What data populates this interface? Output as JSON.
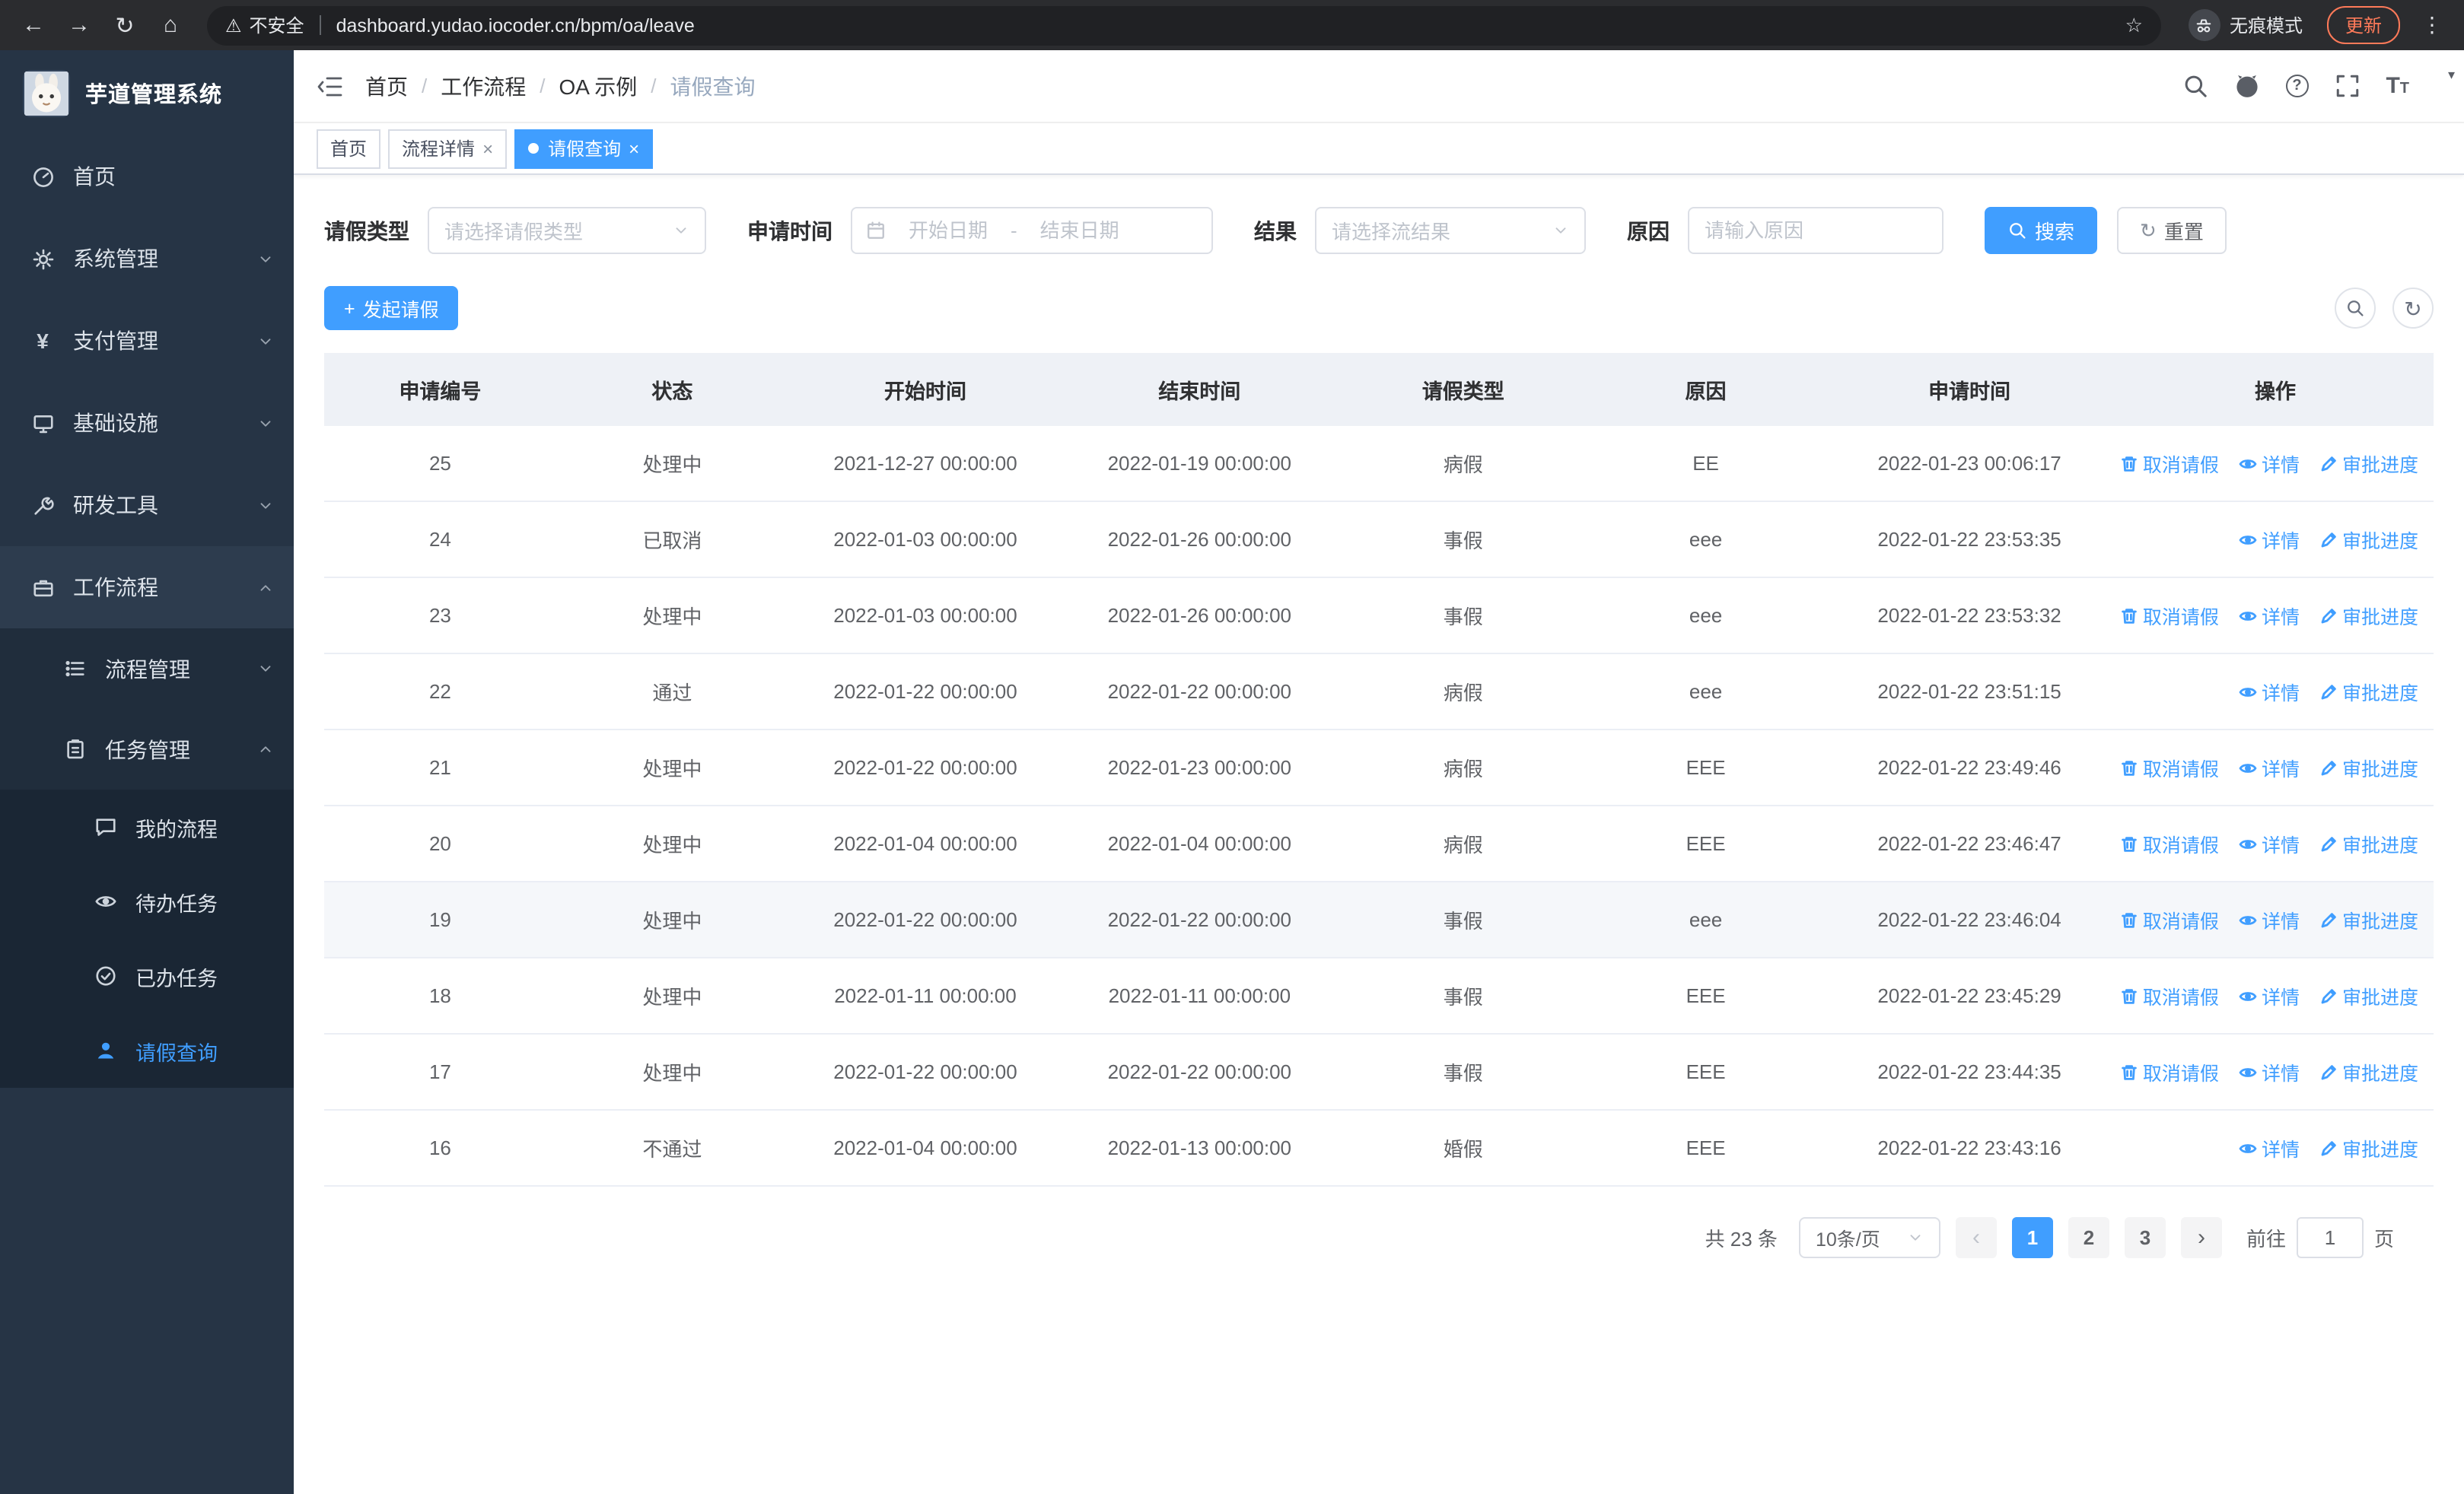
{
  "colors": {
    "accent": "#409eff",
    "sidebar_bg": "#263445",
    "update_pill": "#ff7a59",
    "table_header_bg": "#eef1f6"
  },
  "icons": {
    "close": "×",
    "caret_down": "▾"
  },
  "browser": {
    "back_icon": "←",
    "forward_icon": "→",
    "reload_icon": "↻",
    "home_icon": "⌂",
    "warning_icon": "⚠",
    "security_label": "不安全",
    "url": "dashboard.yudao.iocoder.cn/bpm/oa/leave",
    "star_icon": "☆",
    "incognito_label": "无痕模式",
    "update_label": "更新",
    "menu_dots_icon": "⋮"
  },
  "sidebar": {
    "logo_title": "芋道管理系统",
    "menu": [
      {
        "label": "首页"
      },
      {
        "label": "系统管理"
      },
      {
        "label": "支付管理"
      },
      {
        "label": "基础设施"
      },
      {
        "label": "研发工具"
      },
      {
        "label": "工作流程"
      },
      {
        "label": "流程管理"
      },
      {
        "label": "任务管理"
      },
      {
        "label": "我的流程"
      },
      {
        "label": "待办任务"
      },
      {
        "label": "已办任务"
      },
      {
        "label": "请假查询"
      }
    ]
  },
  "breadcrumb": {
    "items": [
      "首页",
      "工作流程",
      "OA 示例",
      "请假查询"
    ],
    "separator": "/"
  },
  "tabs": [
    {
      "label": "首页"
    },
    {
      "label": "流程详情"
    },
    {
      "label": "请假查询"
    }
  ],
  "filters": {
    "leave_type_label": "请假类型",
    "leave_type_placeholder": "请选择请假类型",
    "apply_time_label": "申请时间",
    "start_placeholder": "开始日期",
    "range_separator": "-",
    "end_placeholder": "结束日期",
    "result_label": "结果",
    "result_placeholder": "请选择流结果",
    "reason_label": "原因",
    "reason_placeholder": "请输入原因",
    "search_label": "搜索",
    "reset_label": "重置"
  },
  "toolbar": {
    "plus_icon": "+",
    "create_label": "发起请假"
  },
  "table": {
    "headers": [
      "申请编号",
      "状态",
      "开始时间",
      "结束时间",
      "请假类型",
      "原因",
      "申请时间",
      "操作"
    ],
    "action_labels": {
      "cancel": "取消请假",
      "detail": "详情",
      "progress": "审批进度"
    },
    "rows": [
      {
        "id": "25",
        "status": "处理中",
        "start": "2021-12-27 00:00:00",
        "end": "2022-01-19 00:00:00",
        "type": "病假",
        "reason": "EE",
        "apply_time": "2022-01-23 00:06:17",
        "can_cancel": true,
        "highlighted": false
      },
      {
        "id": "24",
        "status": "已取消",
        "start": "2022-01-03 00:00:00",
        "end": "2022-01-26 00:00:00",
        "type": "事假",
        "reason": "eee",
        "apply_time": "2022-01-22 23:53:35",
        "can_cancel": false,
        "highlighted": false
      },
      {
        "id": "23",
        "status": "处理中",
        "start": "2022-01-03 00:00:00",
        "end": "2022-01-26 00:00:00",
        "type": "事假",
        "reason": "eee",
        "apply_time": "2022-01-22 23:53:32",
        "can_cancel": true,
        "highlighted": false
      },
      {
        "id": "22",
        "status": "通过",
        "start": "2022-01-22 00:00:00",
        "end": "2022-01-22 00:00:00",
        "type": "病假",
        "reason": "eee",
        "apply_time": "2022-01-22 23:51:15",
        "can_cancel": false,
        "highlighted": false
      },
      {
        "id": "21",
        "status": "处理中",
        "start": "2022-01-22 00:00:00",
        "end": "2022-01-23 00:00:00",
        "type": "病假",
        "reason": "EEE",
        "apply_time": "2022-01-22 23:49:46",
        "can_cancel": true,
        "highlighted": false
      },
      {
        "id": "20",
        "status": "处理中",
        "start": "2022-01-04 00:00:00",
        "end": "2022-01-04 00:00:00",
        "type": "病假",
        "reason": "EEE",
        "apply_time": "2022-01-22 23:46:47",
        "can_cancel": true,
        "highlighted": false
      },
      {
        "id": "19",
        "status": "处理中",
        "start": "2022-01-22 00:00:00",
        "end": "2022-01-22 00:00:00",
        "type": "事假",
        "reason": "eee",
        "apply_time": "2022-01-22 23:46:04",
        "can_cancel": true,
        "highlighted": true
      },
      {
        "id": "18",
        "status": "处理中",
        "start": "2022-01-11 00:00:00",
        "end": "2022-01-11 00:00:00",
        "type": "事假",
        "reason": "EEE",
        "apply_time": "2022-01-22 23:45:29",
        "can_cancel": true,
        "highlighted": false
      },
      {
        "id": "17",
        "status": "处理中",
        "start": "2022-01-22 00:00:00",
        "end": "2022-01-22 00:00:00",
        "type": "事假",
        "reason": "EEE",
        "apply_time": "2022-01-22 23:44:35",
        "can_cancel": true,
        "highlighted": false
      },
      {
        "id": "16",
        "status": "不通过",
        "start": "2022-01-04 00:00:00",
        "end": "2022-01-13 00:00:00",
        "type": "婚假",
        "reason": "EEE",
        "apply_time": "2022-01-22 23:43:16",
        "can_cancel": false,
        "highlighted": false
      }
    ]
  },
  "pagination": {
    "total_label": "共 23 条",
    "page_size_label": "10条/页",
    "prev_icon": "‹",
    "next_icon": "›",
    "pages": [
      "1",
      "2",
      "3"
    ],
    "active_page": "1",
    "goto_label": "前往",
    "goto_value": "1",
    "page_unit_label": "页"
  }
}
